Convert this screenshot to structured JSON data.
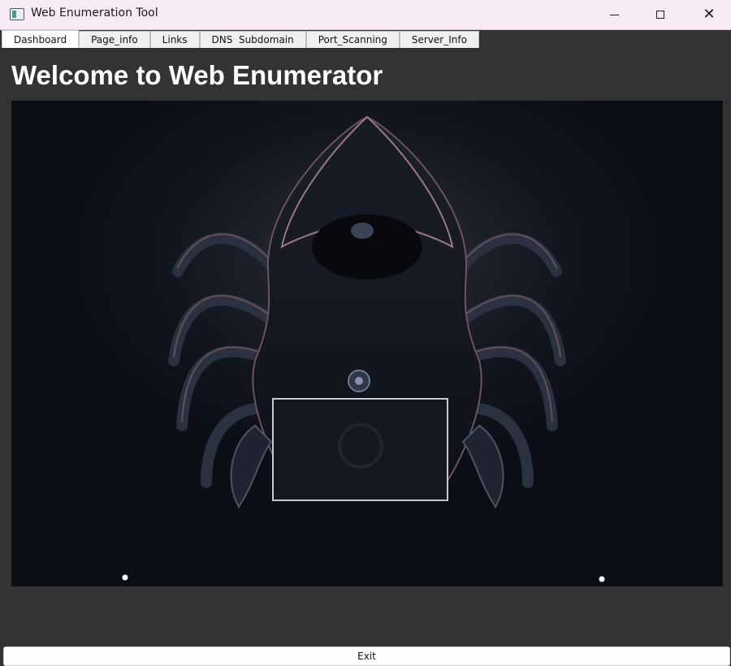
{
  "window": {
    "title": "Web Enumeration Tool",
    "icon": "app-window-icon",
    "controls": [
      "minimize-icon",
      "maximize-icon",
      "close-icon"
    ],
    "close_glyph": "✕"
  },
  "tabs": [
    {
      "label": "Dashboard",
      "active": true
    },
    {
      "label": "Page_info",
      "active": false
    },
    {
      "label": "Links",
      "active": false
    },
    {
      "label": "DNS  Subdomain",
      "active": false
    },
    {
      "label": "Port_Scanning",
      "active": false
    },
    {
      "label": "Server_Info",
      "active": false
    }
  ],
  "main": {
    "heading": "Welcome to Web Enumerator",
    "image": "hooded-hacker-spider-illustration"
  },
  "footer": {
    "exit_label": "Exit"
  },
  "colors": {
    "background": "#333333",
    "titlebar": "#f7ebf6",
    "heading_text": "#ffffff",
    "image_background": "#0b0e14"
  }
}
